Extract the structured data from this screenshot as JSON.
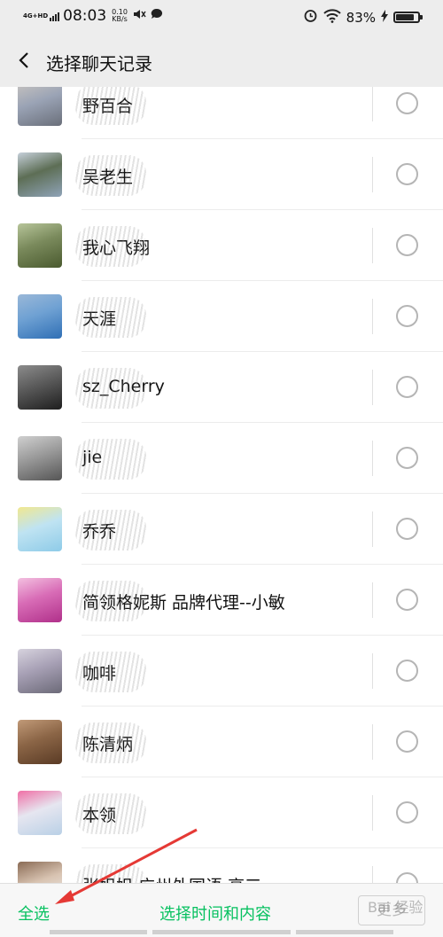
{
  "status": {
    "network": "4G+HD",
    "time": "08:03",
    "speed_value": "0.10",
    "speed_unit": "KB/s",
    "mute_icon": "speaker-mute-icon",
    "message_icon": "chat-bubble-icon",
    "alarm_icon": "alarm-icon",
    "wifi_icon": "wifi-icon",
    "battery_text": "83%",
    "battery_level": 0.83,
    "charging_icon": "lightning-icon"
  },
  "nav": {
    "back_icon": "chevron-left-icon",
    "title": "选择聊天记录"
  },
  "chats": [
    {
      "name": "野百合",
      "avatar_colors": [
        "#6a6f7a",
        "#9aa3b5",
        "#c8c4c0"
      ]
    },
    {
      "name": "吴老生",
      "avatar_colors": [
        "#8fa3b8",
        "#5d6e55",
        "#c6d0da"
      ]
    },
    {
      "name": "我心飞翔",
      "avatar_colors": [
        "#4a5a2f",
        "#7a8a5c",
        "#b7c59a"
      ]
    },
    {
      "name": "天涯",
      "avatar_colors": [
        "#2f6fb5",
        "#6fa1d3",
        "#9ab8d8"
      ]
    },
    {
      "name": "sz_Cherry",
      "avatar_colors": [
        "#1e1e1e",
        "#5a5a5a",
        "#8c8c8c"
      ]
    },
    {
      "name": "jie",
      "avatar_colors": [
        "#555555",
        "#9a9a9a",
        "#d0d0d0"
      ]
    },
    {
      "name": "乔乔",
      "avatar_colors": [
        "#8ecbe8",
        "#bfe3f2",
        "#f1e88f"
      ]
    },
    {
      "name": "简领格妮斯 品牌代理--小敏",
      "avatar_colors": [
        "#b0308a",
        "#d86cb6",
        "#f3c0e0"
      ]
    },
    {
      "name": "咖啡",
      "avatar_colors": [
        "#6c6a78",
        "#a7a0b5",
        "#d7d3de"
      ]
    },
    {
      "name": "陈清炳",
      "avatar_colors": [
        "#5a3b25",
        "#8b6546",
        "#c19a78"
      ]
    },
    {
      "name": "本领",
      "avatar_colors": [
        "#b9d0e6",
        "#e6e6f0",
        "#f06fa6"
      ]
    },
    {
      "name": "张姐姐 广州外国语 高三",
      "avatar_colors": [
        "#f2f2f2",
        "#d8c3b1",
        "#8a6b55"
      ]
    }
  ],
  "bottom": {
    "select_all": "全选",
    "select_range": "选择时间和内容",
    "more": "更多"
  },
  "colors": {
    "accent": "#07c160",
    "annotation_arrow": "#e53935"
  },
  "watermark": "Bai 经验"
}
